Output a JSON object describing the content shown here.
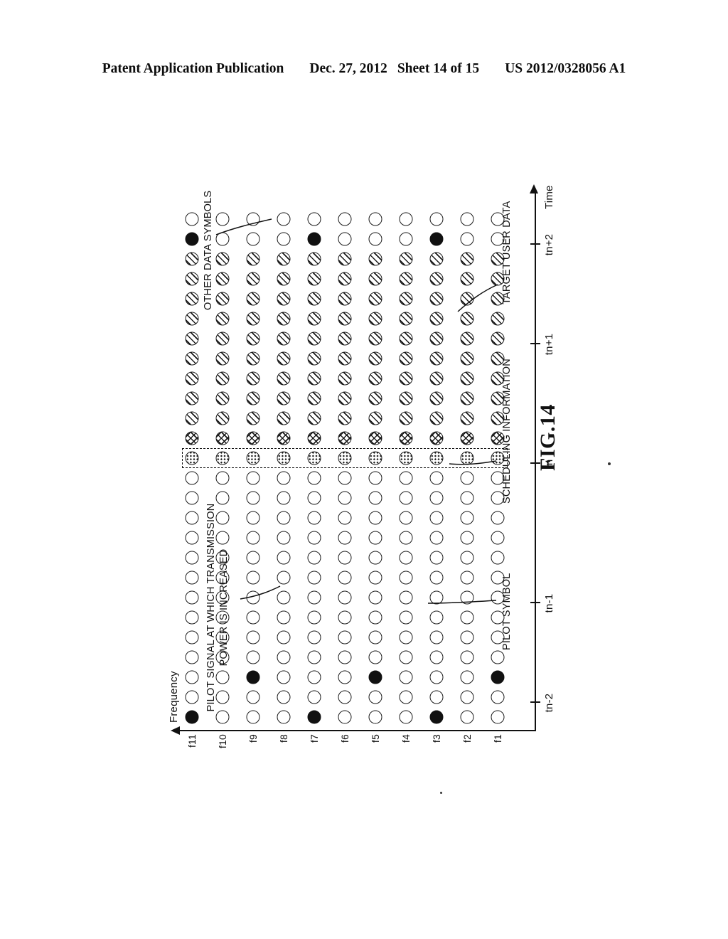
{
  "header": {
    "publication": "Patent Application Publication",
    "date": "Dec. 27, 2012",
    "sheet": "Sheet 14 of 15",
    "patent_number": "US 2012/0328056 A1"
  },
  "figure": {
    "caption": "FIG.14",
    "axes": {
      "x_title": "Time",
      "y_title": "Frequency"
    },
    "time_ticks": [
      "tn-2",
      "tn-1",
      "tn",
      "tn+1",
      "tn+2"
    ],
    "freq_labels": [
      "f11",
      "f10",
      "f9",
      "f8",
      "f7",
      "f6",
      "f5",
      "f4",
      "f3",
      "f2",
      "f1"
    ],
    "callouts": {
      "pilot_power_line1": "PILOT SIGNAL AT WHICH TRANSMISSION",
      "pilot_power_line2": "POWER IS INCREASED",
      "other_data_symbols": "OTHER DATA SYMBOLS",
      "target_user_data": "TARGET USER DATA",
      "scheduling_information": "SCHEDULING INFORMATION",
      "pilot_symbol": "PILOT SYMBOL"
    },
    "legend_symbol_types": {
      "empty": "other-data-symbol",
      "filled": "pilot-symbol",
      "hatch": "target-user-data",
      "cross": "target-user-data-alt",
      "dot": "scheduling-information"
    },
    "colors": {
      "ink": "#111111",
      "paper": "#ffffff"
    }
  },
  "chart_data": {
    "type": "heatmap",
    "title": "FIG.14",
    "xlabel": "Time",
    "ylabel": "Frequency",
    "x_tick_labels": [
      "tn-2",
      "tn-1",
      "tn",
      "tn+1",
      "tn+2"
    ],
    "x_tick_columns": [
      1,
      6,
      13,
      19,
      24
    ],
    "columns": 26,
    "rows": 11,
    "row_labels": [
      "f11",
      "f10",
      "f9",
      "f8",
      "f7",
      "f6",
      "f5",
      "f4",
      "f3",
      "f2",
      "f1"
    ],
    "symbol_key": {
      "O": "empty circle - other data symbols",
      "F": "filled circle - pilot symbol / pilot signal with increased transmission power",
      "H": "diagonal hatched circle - target user data",
      "X": "cross hatched circle - target user data",
      "D": "dotted circle - scheduling information"
    },
    "grid": [
      "FOOOOOOOOOOOODXHHHHHHHHHFOO",
      "OOOOOOOOOOOOODXHHHHHHHHHOOO",
      "OOFOOOOOOOOOODXHHHHHHHHHOOO",
      "OOOOOOOOOOOOODXHHHHHHHHHOOO",
      "FOOOOOOOOOOOODXHHHHHHHHHFOO",
      "OOOOOOOOOOOOODXHHHHHHHHHOOO",
      "OOFOOOOOOOOOODXHHHHHHHHHOOO",
      "OOOOOOOOOOOOODXHHHHHHHHHOOO",
      "FOOOOOOOOOOOODXHHHHHHHHHFOO",
      "OOOOOOOOOOOOODXHHHHHHHHHOOO",
      "OOFOOOOOOOOOODXHHHHHHHHHOOO"
    ],
    "grid_note": "Columns ordered left-to-right = increasing time. Columns 0-12 empty-circle region (before tn), column 13 dotted (scheduling information at tn), columns 14-15 cross hatch, columns 16-23 diagonal hatch (target user data), columns 24-25 empty circles after tn+2.",
    "legend_position": "annotations"
  }
}
